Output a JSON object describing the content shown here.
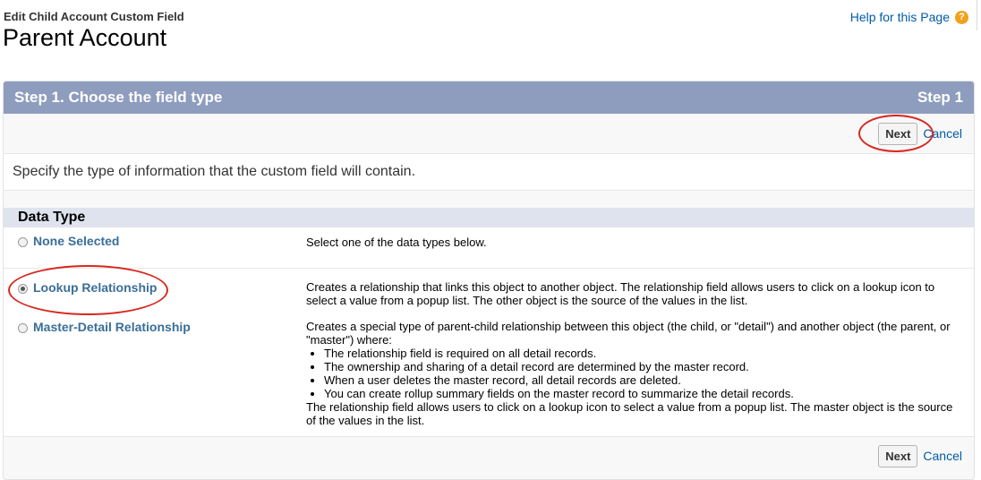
{
  "header": {
    "pre_title": "Edit Child Account Custom Field",
    "title": "Parent Account",
    "help_link": "Help for this Page",
    "help_icon": "?"
  },
  "panel": {
    "step_title": "Step 1. Choose the field type",
    "step_indicator": "Step 1",
    "next_label": "Next",
    "cancel_label": "Cancel",
    "instructions": "Specify the type of information that the custom field will contain."
  },
  "data_type": {
    "section_title": "Data Type",
    "options": [
      {
        "label": "None Selected",
        "selected": false,
        "description": "Select one of the data types below."
      },
      {
        "label": "Lookup Relationship",
        "selected": true,
        "description": "Creates a relationship that links this object to another object. The relationship field allows users to click on a lookup icon to select a value from a popup list. The other object is the source of the values in the list."
      },
      {
        "label": "Master-Detail Relationship",
        "selected": false,
        "description_intro": "Creates a special type of parent-child relationship between this object (the child, or \"detail\") and another object (the parent, or \"master\") where:",
        "bullets": [
          "The relationship field is required on all detail records.",
          "The ownership and sharing of a detail record are determined by the master record.",
          "When a user deletes the master record, all detail records are deleted.",
          "You can create rollup summary fields on the master record to summarize the detail records."
        ],
        "description_outro": "The relationship field allows users to click on a lookup icon to select a value from a popup list. The master object is the source of the values in the list."
      }
    ]
  },
  "colors": {
    "header_bar": "#8e9dbe",
    "section_bar": "#dfe3ee",
    "link": "#015ba7",
    "annotation": "#d7281e"
  }
}
